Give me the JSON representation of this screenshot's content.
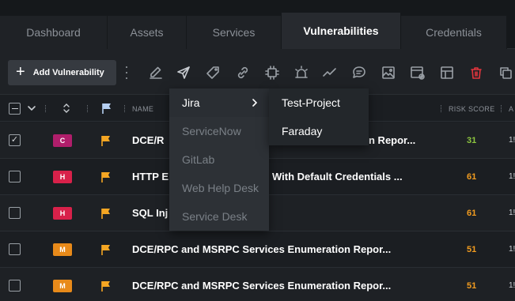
{
  "tabs": [
    {
      "label": "Dashboard"
    },
    {
      "label": "Assets"
    },
    {
      "label": "Services"
    },
    {
      "label": "Vulnerabilities",
      "active": true
    },
    {
      "label": "Credentials"
    }
  ],
  "toolbar": {
    "add_label": "Add Vulnerability",
    "tools": [
      "edit-icon",
      "send-icon",
      "tag-icon",
      "link-icon",
      "api-icon",
      "alarm-icon",
      "chart-icon",
      "comment-icon",
      "image-icon",
      "evidence-icon",
      "layout-icon",
      "trash-icon",
      "copy-icon"
    ]
  },
  "table": {
    "headers": {
      "name": "NAME",
      "risk_score": "RISK SCORE",
      "extra": "A"
    },
    "rows": [
      {
        "severity": "C",
        "severity_color": "#b01e6b",
        "name": "DCE/R",
        "score": "31",
        "score_color": "#8dc63f",
        "extra": "1!",
        "checked": true
      },
      {
        "severity": "H",
        "severity_color": "#d8214a",
        "name": "HTTP E",
        "score": "61",
        "score_color": "#f29c1f",
        "extra": "1!",
        "checked": false
      },
      {
        "severity": "H",
        "severity_color": "#d8214a",
        "name": "SQL Inj",
        "score": "61",
        "score_color": "#f29c1f",
        "extra": "1!",
        "checked": false
      },
      {
        "severity": "M",
        "severity_color": "#e88a1a",
        "name": "DCE/RPC and MSRPC Services Enumeration Repor...",
        "score": "51",
        "score_color": "#f29c1f",
        "extra": "1!",
        "checked": false
      },
      {
        "severity": "M",
        "severity_color": "#e88a1a",
        "name": "DCE/RPC and MSRPC Services Enumeration Repor...",
        "score": "51",
        "score_color": "#f29c1f",
        "extra": "1!",
        "checked": false
      }
    ],
    "visible_fragments": [
      "n Repor...",
      "With Default Credentials ..."
    ]
  },
  "dropdown": {
    "items": [
      "Jira",
      "ServiceNow",
      "GitLab",
      "Web Help Desk",
      "Service Desk"
    ],
    "submenu": [
      "Test-Project",
      "Faraday"
    ]
  },
  "colors": {
    "flag": "#f5a623",
    "flag_header": "#b6d0f2"
  }
}
